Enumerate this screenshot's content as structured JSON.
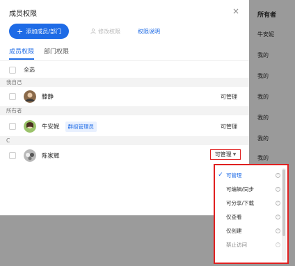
{
  "background": {
    "header": "所有者",
    "cells": [
      "牛安妮",
      "我的",
      "我的",
      "我的",
      "我的",
      "我的",
      "我的"
    ]
  },
  "modal": {
    "title": "成员权限",
    "close_icon": "×",
    "add_button": "添加成员/部门",
    "edit_permission": "修改权限",
    "permission_explain": "权限说明",
    "tabs": [
      {
        "label": "成员权限",
        "active": true
      },
      {
        "label": "部门权限",
        "active": false
      }
    ],
    "select_all": "全选",
    "sections": [
      {
        "label": "我自己"
      },
      {
        "label": "所有者"
      },
      {
        "label": "C"
      }
    ],
    "members": [
      {
        "name": "滕静",
        "permission": "可管理"
      },
      {
        "name": "牛安妮",
        "tag": "群组管理员",
        "permission": "可管理"
      },
      {
        "name": "陈家辉",
        "permission": "可管理"
      }
    ]
  },
  "dropdown": {
    "items": [
      {
        "label": "可管理",
        "selected": true
      },
      {
        "label": "可编辑/同步",
        "selected": false
      },
      {
        "label": "可分享/下载",
        "selected": false
      },
      {
        "label": "仅查看",
        "selected": false
      },
      {
        "label": "仅创建",
        "selected": false
      },
      {
        "label": "禁止访问",
        "selected": false
      }
    ]
  },
  "colors": {
    "accent": "#1e6be6",
    "highlight_border": "#e02020"
  }
}
